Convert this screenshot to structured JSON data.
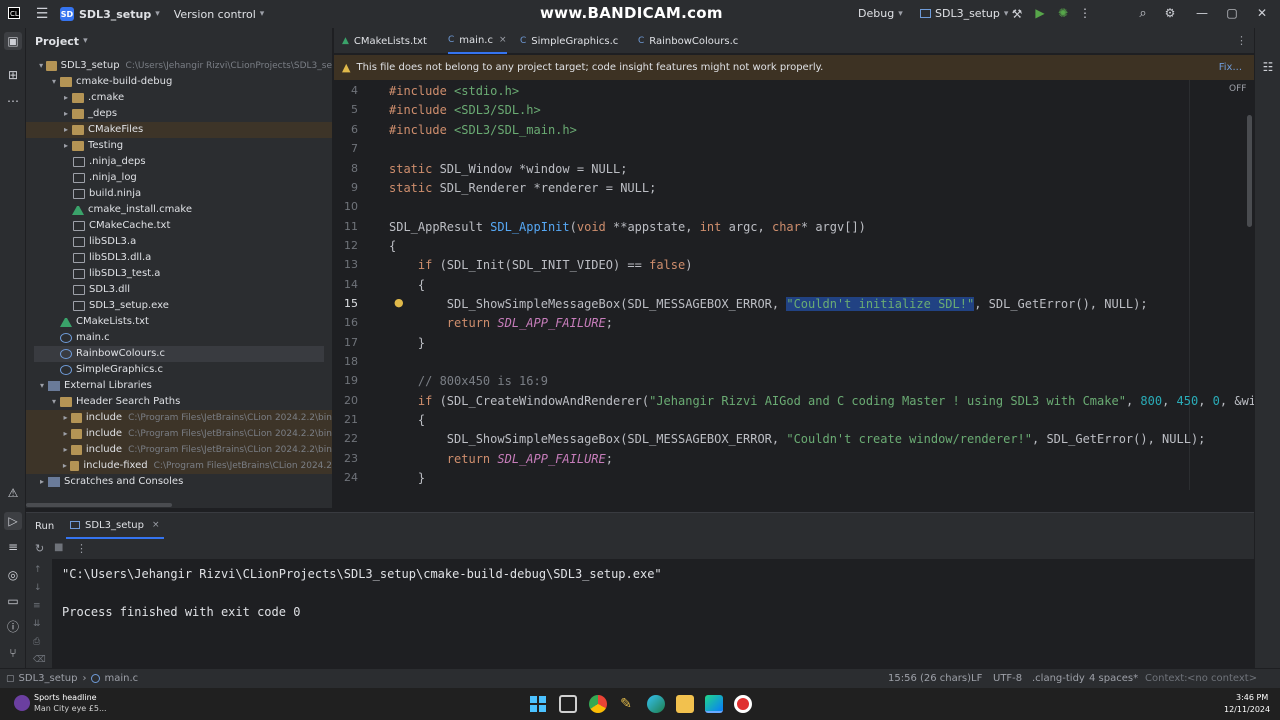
{
  "titlebar": {
    "project_badge": "SD",
    "project_name": "SDL3_setup",
    "version_control": "Version control",
    "watermark": "www.BANDICAM.com",
    "run_config_mode": "Debug",
    "run_config_target": "SDL3_setup"
  },
  "project_panel": {
    "title": "Project",
    "tree": [
      {
        "label": "SDL3_setup",
        "hint": "C:\\Users\\Jehangir Rizvi\\CLionProjects\\SDL3_se"
      },
      {
        "label": "cmake-build-debug",
        "hint": ""
      },
      {
        "label": ".cmake",
        "hint": ""
      },
      {
        "label": "_deps",
        "hint": ""
      },
      {
        "label": "CMakeFiles",
        "hint": ""
      },
      {
        "label": "Testing",
        "hint": ""
      },
      {
        "label": ".ninja_deps",
        "hint": ""
      },
      {
        "label": ".ninja_log",
        "hint": ""
      },
      {
        "label": "build.ninja",
        "hint": ""
      },
      {
        "label": "cmake_install.cmake",
        "hint": ""
      },
      {
        "label": "CMakeCache.txt",
        "hint": ""
      },
      {
        "label": "libSDL3.a",
        "hint": ""
      },
      {
        "label": "libSDL3.dll.a",
        "hint": ""
      },
      {
        "label": "libSDL3_test.a",
        "hint": ""
      },
      {
        "label": "SDL3.dll",
        "hint": ""
      },
      {
        "label": "SDL3_setup.exe",
        "hint": ""
      },
      {
        "label": "CMakeLists.txt",
        "hint": ""
      },
      {
        "label": "main.c",
        "hint": ""
      },
      {
        "label": "RainbowColours.c",
        "hint": ""
      },
      {
        "label": "SimpleGraphics.c",
        "hint": ""
      },
      {
        "label": "External Libraries",
        "hint": ""
      },
      {
        "label": "Header Search Paths",
        "hint": ""
      },
      {
        "label": "include",
        "hint": "C:\\Program Files\\JetBrains\\CLion 2024.2.2\\bin"
      },
      {
        "label": "include",
        "hint": "C:\\Program Files\\JetBrains\\CLion 2024.2.2\\bin"
      },
      {
        "label": "include",
        "hint": "C:\\Program Files\\JetBrains\\CLion 2024.2.2\\bin"
      },
      {
        "label": "include-fixed",
        "hint": "C:\\Program Files\\JetBrains\\CLion 2024.2"
      },
      {
        "label": "Scratches and Consoles",
        "hint": ""
      }
    ]
  },
  "tabs": [
    {
      "label": "CMakeLists.txt",
      "icon": "▲"
    },
    {
      "label": "main.c",
      "icon": "C"
    },
    {
      "label": "SimpleGraphics.c",
      "icon": "C"
    },
    {
      "label": "RainbowColours.c",
      "icon": "C"
    }
  ],
  "tab_close_glyph": "×",
  "banner": {
    "message": "This file does not belong to any project target; code insight features might not work properly.",
    "action": "Fix..."
  },
  "editor": {
    "off_label": "OFF",
    "line_numbers": [
      "4",
      "5",
      "6",
      "7",
      "8",
      "9",
      "10",
      "11",
      "12",
      "13",
      "14",
      "15",
      "16",
      "17",
      "18",
      "19",
      "20",
      "21",
      "22",
      "23",
      "24"
    ],
    "current_line": "15",
    "code": {
      "l4a": "#include ",
      "l4b": "<stdio.h>",
      "l5a": "#include ",
      "l5b": "<SDL3/SDL.h>",
      "l6a": "#include ",
      "l6b": "<SDL3/SDL_main.h>",
      "l8a": "static ",
      "l8b": "SDL_Window *window = NULL;",
      "l9a": "static ",
      "l9b": "SDL_Renderer *renderer = NULL;",
      "l11a": "SDL_AppResult ",
      "l11b": "SDL_AppInit",
      "l11c": "(",
      "l11d": "void",
      "l11e": " **appstate, ",
      "l11f": "int",
      "l11g": " argc, ",
      "l11h": "char",
      "l11i": "* argv[])",
      "l12": "{",
      "l13a": "    ",
      "l13b": "if",
      "l13c": " (SDL_Init(SDL_INIT_VIDEO) == ",
      "l13d": "false",
      "l13e": ")",
      "l14": "    {",
      "l15a": "        SDL_ShowSimpleMessageBox(SDL_MESSAGEBOX_ERROR, ",
      "l15b": "\"Couldn't initialize SDL!\"",
      "l15c": ", SDL_GetError(), NULL);",
      "l16a": "        ",
      "l16b": "return",
      "l16c": " ",
      "l16d": "SDL_APP_FAILURE",
      "l16e": ";",
      "l17": "    }",
      "l19": "    // 800x450 is 16:9",
      "l20a": "    ",
      "l20b": "if",
      "l20c": " (SDL_CreateWindowAndRenderer(",
      "l20d": "\"Jehangir Rizvi AIGod and C coding Master ! using SDL3 with Cmake\"",
      "l20e": ", ",
      "l20f": "800",
      "l20g": ", ",
      "l20h": "450",
      "l20i": ", ",
      "l20j": "0",
      "l20k": ", &window, &ren",
      "l21": "    {",
      "l22a": "        SDL_ShowSimpleMessageBox(SDL_MESSAGEBOX_ERROR, ",
      "l22b": "\"Couldn't create window/renderer!\"",
      "l22c": ", SDL_GetError(), NULL);",
      "l23a": "        ",
      "l23b": "return",
      "l23c": " ",
      "l23d": "SDL_APP_FAILURE",
      "l23e": ";",
      "l24": "    }"
    }
  },
  "run_panel": {
    "title": "Run",
    "tab_label": "SDL3_setup",
    "output_line1": "\"C:\\Users\\Jehangir Rizvi\\CLionProjects\\SDL3_setup\\cmake-build-debug\\SDL3_setup.exe\"",
    "output_line2": "Process finished with exit code 0"
  },
  "statusbar": {
    "crumb_project": "SDL3_setup",
    "crumb_file": "main.c",
    "position": "15:56 (26 chars)",
    "line_sep": "LF",
    "encoding": "UTF-8",
    "linter": ".clang-tidy",
    "indent": "4 spaces*",
    "context_label": "Context:",
    "context_value": "<no context>"
  },
  "taskbar": {
    "news_title": "Sports headline",
    "news_sub": "Man City eye £5...",
    "time": "3:46 PM",
    "date": "12/11/2024"
  },
  "colors": {
    "accent": "#3574f0",
    "banner_bg": "#3d3223",
    "selection": "#214283"
  }
}
